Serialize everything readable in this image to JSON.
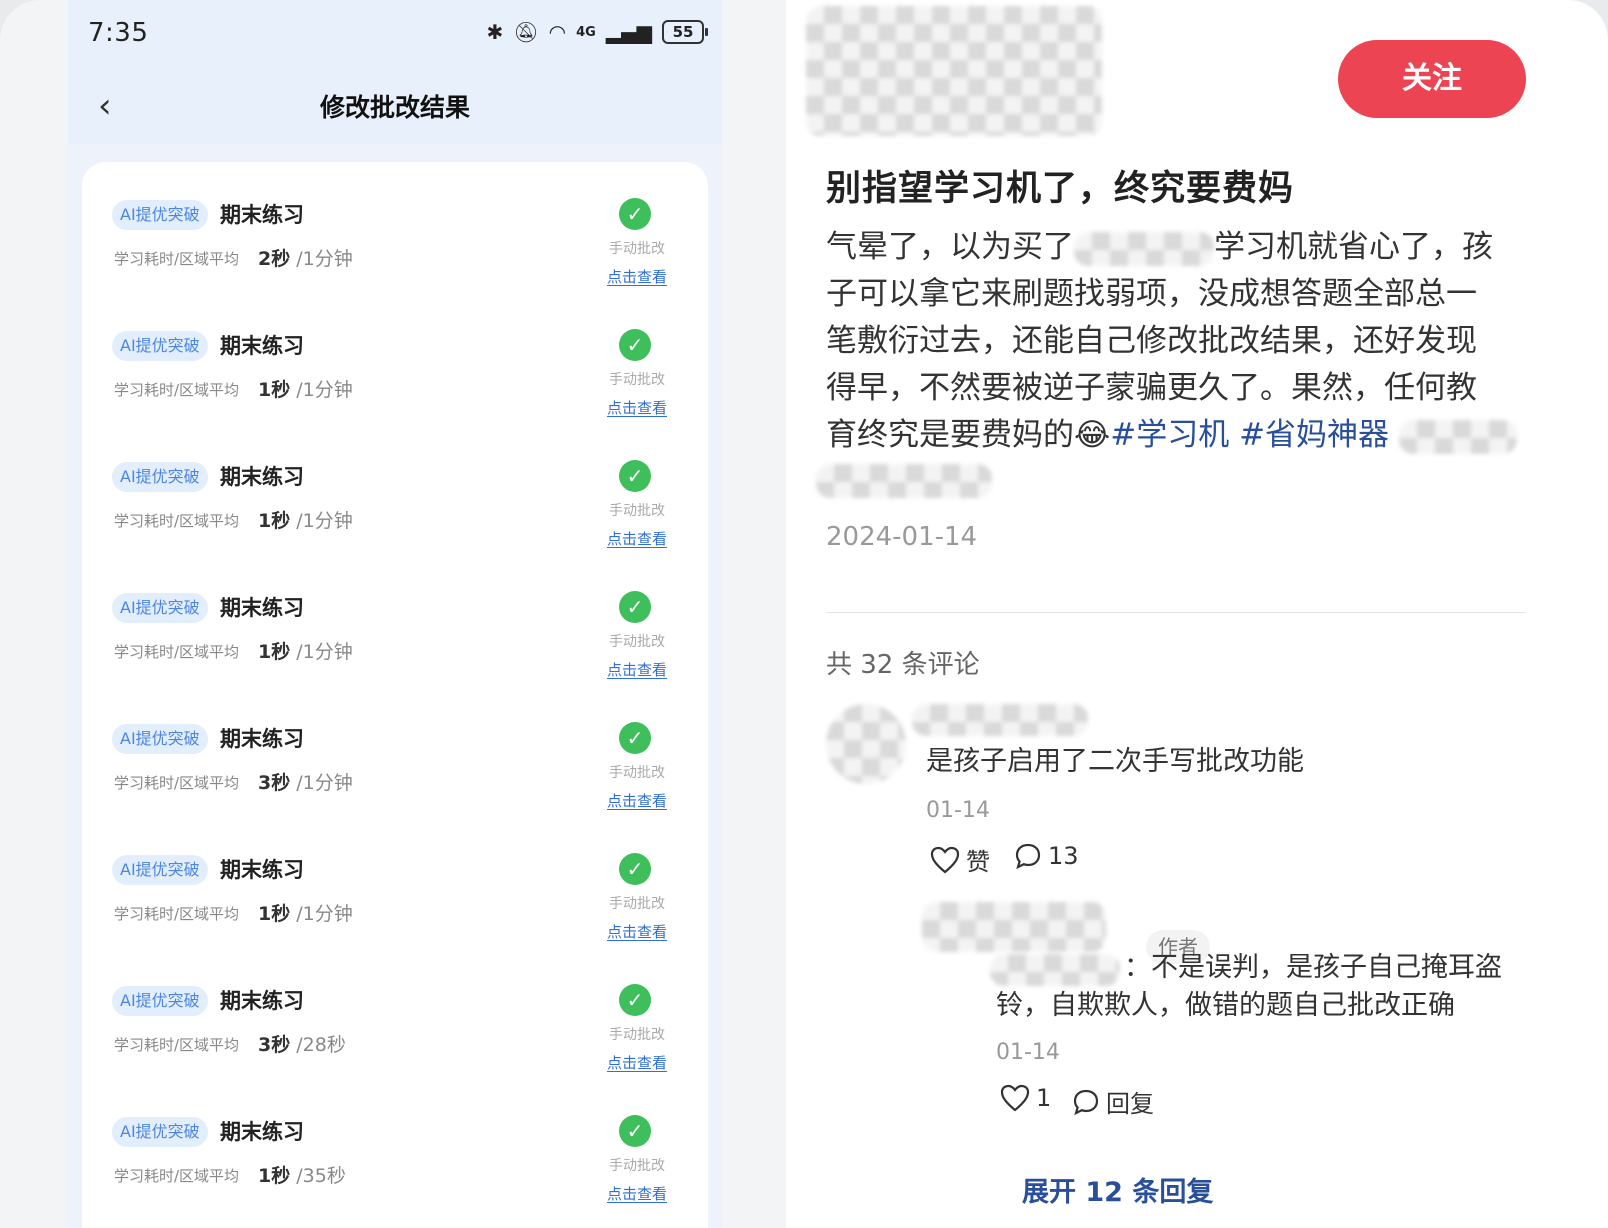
{
  "status_bar": {
    "time": "7:35",
    "battery": "55",
    "network": "4G"
  },
  "nav": {
    "title": "修改批改结果"
  },
  "records": [
    {
      "tag": "AI提优突破",
      "title": "期末练习",
      "stat_label": "学习耗时/区域平均",
      "time": "2秒",
      "avg": "/1分钟",
      "mode": "手动批改",
      "link": "点击查看"
    },
    {
      "tag": "AI提优突破",
      "title": "期末练习",
      "stat_label": "学习耗时/区域平均",
      "time": "1秒",
      "avg": "/1分钟",
      "mode": "手动批改",
      "link": "点击查看"
    },
    {
      "tag": "AI提优突破",
      "title": "期末练习",
      "stat_label": "学习耗时/区域平均",
      "time": "1秒",
      "avg": "/1分钟",
      "mode": "手动批改",
      "link": "点击查看"
    },
    {
      "tag": "AI提优突破",
      "title": "期末练习",
      "stat_label": "学习耗时/区域平均",
      "time": "1秒",
      "avg": "/1分钟",
      "mode": "手动批改",
      "link": "点击查看"
    },
    {
      "tag": "AI提优突破",
      "title": "期末练习",
      "stat_label": "学习耗时/区域平均",
      "time": "3秒",
      "avg": "/1分钟",
      "mode": "手动批改",
      "link": "点击查看"
    },
    {
      "tag": "AI提优突破",
      "title": "期末练习",
      "stat_label": "学习耗时/区域平均",
      "time": "1秒",
      "avg": "/1分钟",
      "mode": "手动批改",
      "link": "点击查看"
    },
    {
      "tag": "AI提优突破",
      "title": "期末练习",
      "stat_label": "学习耗时/区域平均",
      "time": "3秒",
      "avg": "/28秒",
      "mode": "手动批改",
      "link": "点击查看"
    },
    {
      "tag": "AI提优突破",
      "title": "期末练习",
      "stat_label": "学习耗时/区域平均",
      "time": "1秒",
      "avg": "/35秒",
      "mode": "手动批改",
      "link": "点击查看"
    }
  ],
  "post": {
    "follow_label": "关注",
    "title": "别指望学习机了，终究要费妈",
    "body_lines": [
      "气晕了，以为买了",
      "学习机就省心了，孩",
      "子可以拿它来刷题找弱项，没成想答题全部总一",
      "笔敷衍过去，还能自己修改批改结果，还好发现",
      "得早，不然要被逆子蒙骗更久了。果然，任何教",
      "育终究是要费妈的😂"
    ],
    "hashtags": [
      "#学习机",
      "#省妈神器"
    ],
    "date": "2024-01-14"
  },
  "comments": {
    "count_label": "共 32 条评论",
    "first": {
      "text": "是孩子启用了二次手写批改功能",
      "date": "01-14",
      "like_label": "赞",
      "reply_count": "13"
    },
    "reply": {
      "badge": "作者",
      "text_line1": "：不是误判，是孩子自己掩耳盗",
      "text_line2": "铃，自欺欺人，做错的题自己批改正确",
      "date": "01-14",
      "like_count": "1",
      "reply_label": "回复"
    },
    "expand_label": "展开 12 条回复"
  },
  "colors": {
    "accent": "#ec4452",
    "link": "#2a4f9a",
    "check": "#3fbf5c",
    "tag_text": "#4d86e0"
  },
  "icons": [
    "back-icon",
    "bluetooth-icon",
    "mute-icon",
    "wifi-icon",
    "signal-icon",
    "battery-icon",
    "check-icon",
    "heart-icon",
    "comment-bubble-icon"
  ]
}
